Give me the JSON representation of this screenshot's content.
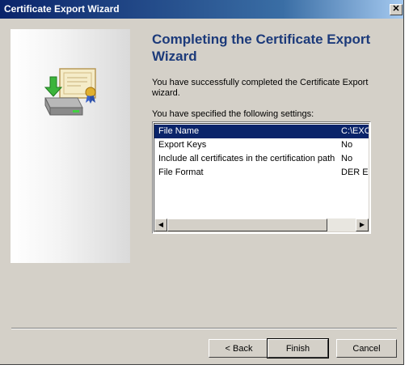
{
  "window": {
    "title": "Certificate Export Wizard",
    "close_glyph": "✕"
  },
  "content": {
    "heading": "Completing the Certificate Export Wizard",
    "success_text": "You have successfully completed the Certificate Export wizard.",
    "settings_label": "You have specified the following settings:",
    "settings": [
      {
        "name": "File Name",
        "value": "C:\\EXC",
        "selected": true
      },
      {
        "name": "Export Keys",
        "value": "No",
        "selected": false
      },
      {
        "name": "Include all certificates in the certification path",
        "value": "No",
        "selected": false
      },
      {
        "name": "File Format",
        "value": "DER En",
        "selected": false
      }
    ],
    "scroll_left_glyph": "◀",
    "scroll_right_glyph": "▶"
  },
  "buttons": {
    "back": "< Back",
    "finish": "Finish",
    "cancel": "Cancel"
  },
  "icons": {
    "wizard_art": "certificate-export-icon"
  }
}
